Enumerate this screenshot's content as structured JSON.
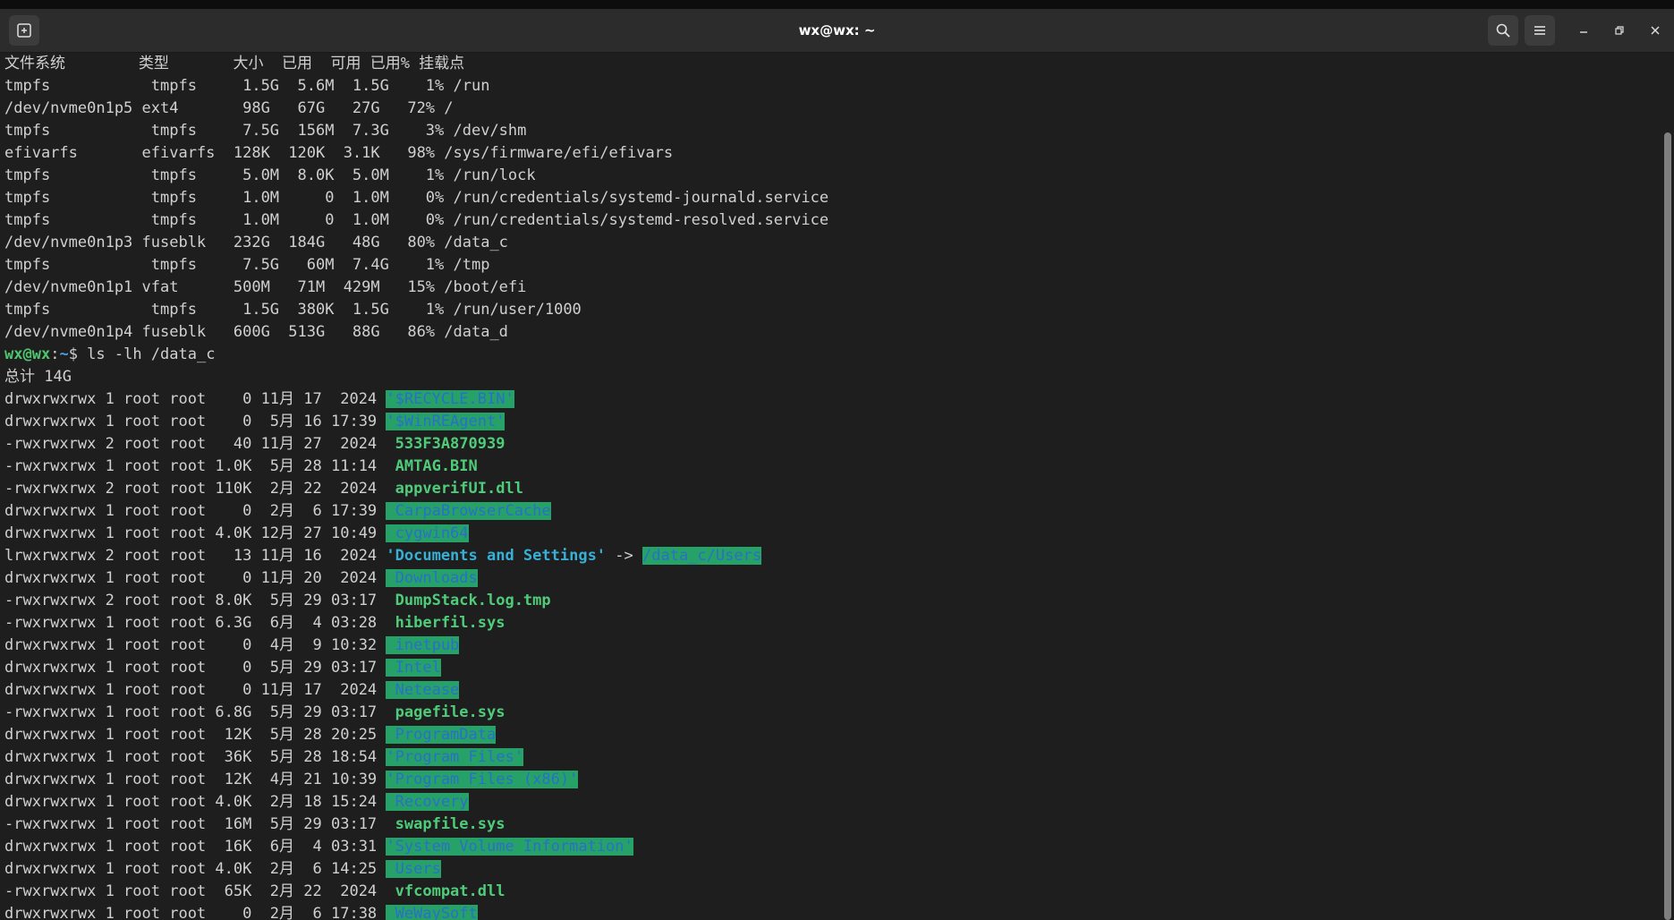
{
  "window": {
    "title": "wx@wx: ~",
    "icons": [
      "new-tab-icon",
      "search-icon",
      "menu-icon",
      "minimize-icon",
      "restore-icon",
      "close-icon"
    ]
  },
  "df": {
    "header": "文件系统        类型       大小  已用  可用 已用% 挂载点",
    "rows": [
      "tmpfs           tmpfs     1.5G  5.6M  1.5G    1% /run",
      "/dev/nvme0n1p5 ext4       98G   67G   27G   72% /",
      "tmpfs           tmpfs     7.5G  156M  7.3G    3% /dev/shm",
      "efivarfs       efivarfs  128K  120K  3.1K   98% /sys/firmware/efi/efivars",
      "tmpfs           tmpfs     5.0M  8.0K  5.0M    1% /run/lock",
      "tmpfs           tmpfs     1.0M     0  1.0M    0% /run/credentials/systemd-journald.service",
      "tmpfs           tmpfs     1.0M     0  1.0M    0% /run/credentials/systemd-resolved.service",
      "/dev/nvme0n1p3 fuseblk   232G  184G   48G   80% /data_c",
      "tmpfs           tmpfs     7.5G   60M  7.4G    1% /tmp",
      "/dev/nvme0n1p1 vfat      500M   71M  429M   15% /boot/efi",
      "tmpfs           tmpfs     1.5G  380K  1.5G    1% /run/user/1000",
      "/dev/nvme0n1p4 fuseblk   600G  513G   88G   86% /data_d"
    ]
  },
  "prompt": {
    "user": "wx@wx",
    "sep": ":",
    "path": "~",
    "symbol": "$ ",
    "command": "ls -lh /data_c"
  },
  "ls": {
    "total": "总计 14G",
    "entries": [
      {
        "meta": "drwxrwxrwx 1 root root    0 11月 17  2024 ",
        "name": "'$RECYCLE.BIN'",
        "type": "dir"
      },
      {
        "meta": "drwxrwxrwx 1 root root    0  5月 16 17:39 ",
        "name": "'$WinREAgent'",
        "type": "dir"
      },
      {
        "meta": "-rwxrwxrwx 2 root root   40 11月 27  2024 ",
        "name": " 533F3A870939",
        "type": "exe"
      },
      {
        "meta": "-rwxrwxrwx 1 root root 1.0K  5月 28 11:14 ",
        "name": " AMTAG.BIN",
        "type": "exe"
      },
      {
        "meta": "-rwxrwxrwx 2 root root 110K  2月 22  2024 ",
        "name": " appverifUI.dll",
        "type": "exe"
      },
      {
        "meta": "drwxrwxrwx 1 root root    0  2月  6 17:39 ",
        "name": " CarpaBrowserCache",
        "type": "dir"
      },
      {
        "meta": "drwxrwxrwx 1 root root 4.0K 12月 27 10:49 ",
        "name": " cygwin64",
        "type": "dir"
      },
      {
        "meta": "lrwxrwxrwx 2 root root   13 11月 16  2024 ",
        "name": "'Documents and Settings'",
        "type": "link",
        "arrow": " -> ",
        "target": "/data_c/Users"
      },
      {
        "meta": "drwxrwxrwx 1 root root    0 11月 20  2024 ",
        "name": " Downloads",
        "type": "dir"
      },
      {
        "meta": "-rwxrwxrwx 2 root root 8.0K  5月 29 03:17 ",
        "name": " DumpStack.log.tmp",
        "type": "exe"
      },
      {
        "meta": "-rwxrwxrwx 1 root root 6.3G  6月  4 03:28 ",
        "name": " hiberfil.sys",
        "type": "exe"
      },
      {
        "meta": "drwxrwxrwx 1 root root    0  4月  9 10:32 ",
        "name": " inetpub",
        "type": "dir"
      },
      {
        "meta": "drwxrwxrwx 1 root root    0  5月 29 03:17 ",
        "name": " Intel",
        "type": "dir"
      },
      {
        "meta": "drwxrwxrwx 1 root root    0 11月 17  2024 ",
        "name": " Netease",
        "type": "dir"
      },
      {
        "meta": "-rwxrwxrwx 1 root root 6.8G  5月 29 03:17 ",
        "name": " pagefile.sys",
        "type": "exe"
      },
      {
        "meta": "drwxrwxrwx 1 root root  12K  5月 28 20:25 ",
        "name": " ProgramData",
        "type": "dir"
      },
      {
        "meta": "drwxrwxrwx 1 root root  36K  5月 28 18:54 ",
        "name": "'Program Files'",
        "type": "dir"
      },
      {
        "meta": "drwxrwxrwx 1 root root  12K  4月 21 10:39 ",
        "name": "'Program Files (x86)'",
        "type": "dir"
      },
      {
        "meta": "drwxrwxrwx 1 root root 4.0K  2月 18 15:24 ",
        "name": " Recovery",
        "type": "dir"
      },
      {
        "meta": "-rwxrwxrwx 1 root root  16M  5月 29 03:17 ",
        "name": " swapfile.sys",
        "type": "exe"
      },
      {
        "meta": "drwxrwxrwx 1 root root  16K  6月  4 03:31 ",
        "name": "'System Volume Information'",
        "type": "dir"
      },
      {
        "meta": "drwxrwxrwx 1 root root 4.0K  2月  6 14:25 ",
        "name": " Users",
        "type": "dir"
      },
      {
        "meta": "-rwxrwxrwx 1 root root  65K  2月 22  2024 ",
        "name": " vfcompat.dll",
        "type": "exe"
      },
      {
        "meta": "drwxrwxrwx 1 root root    0  2月  6 17:38 ",
        "name": " WeWaySoft",
        "type": "dir"
      }
    ]
  },
  "colors": {
    "background": "#1e1e1e",
    "dir_highlight": "#26a269",
    "dir_text": "#2a6fc8",
    "executable": "#4fcc7a",
    "symlink": "#36b0d6",
    "prompt_user": "#4fc56f"
  }
}
